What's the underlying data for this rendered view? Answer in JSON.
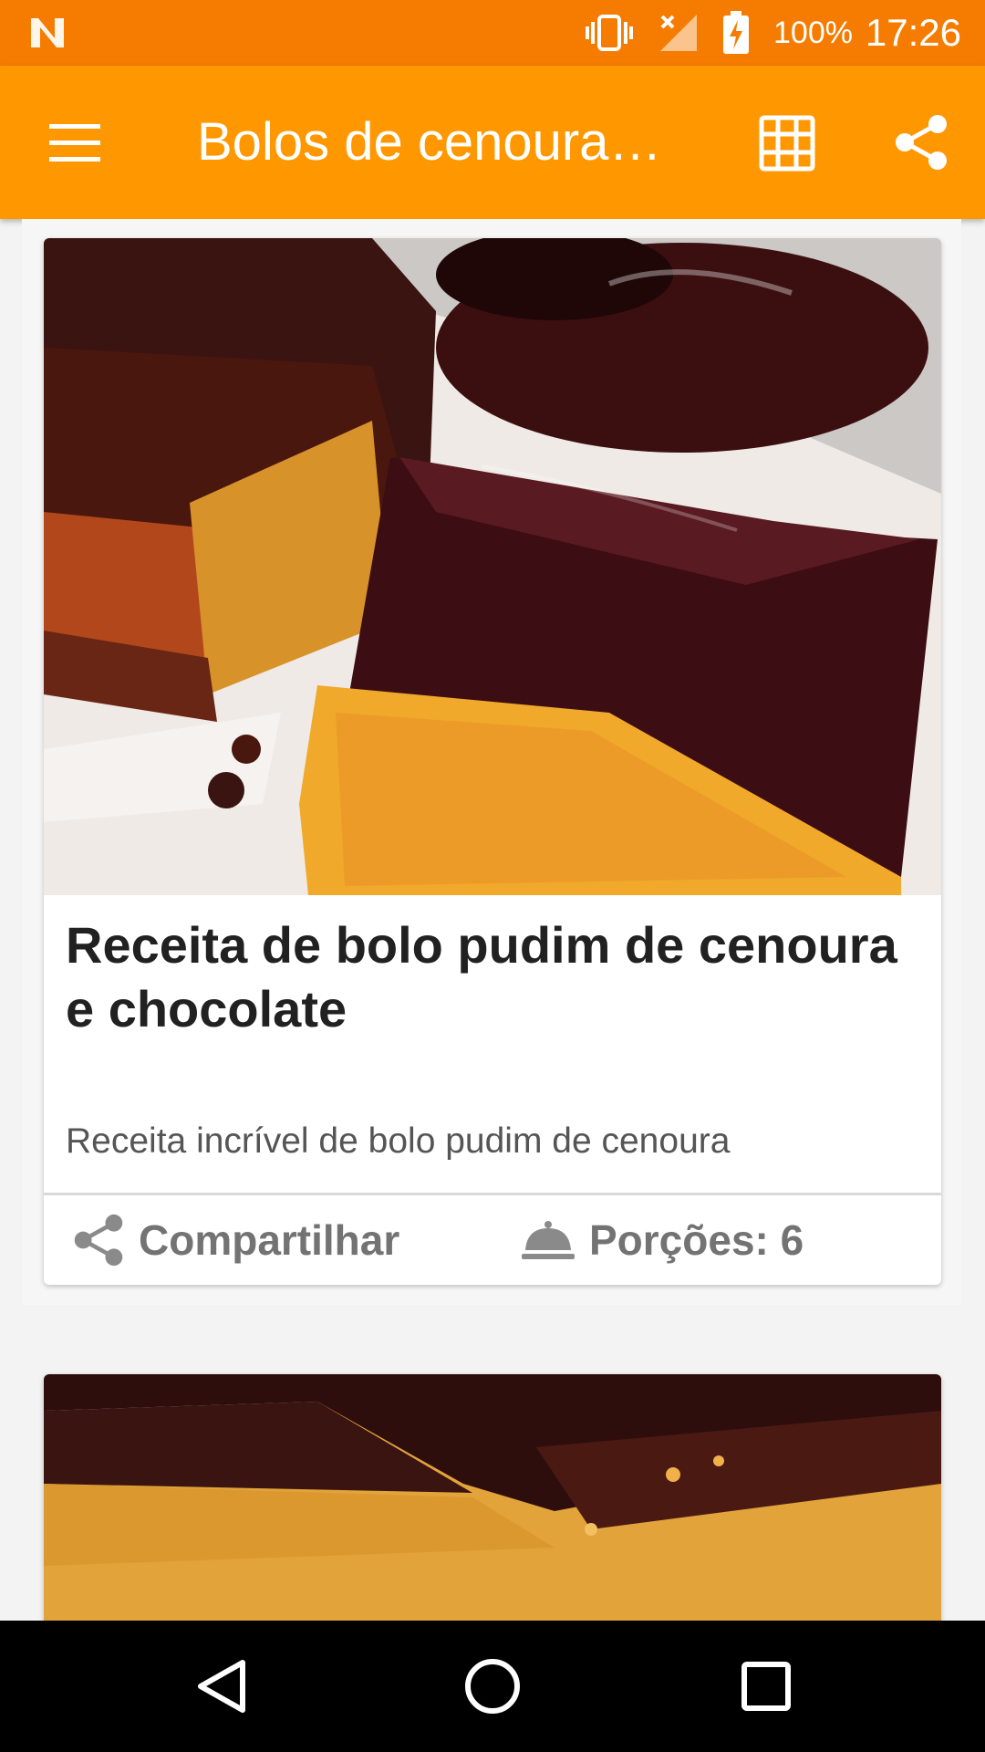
{
  "status_bar": {
    "battery": "100%",
    "time": "17:26",
    "icons": [
      "n-notification-icon",
      "vibrate-icon",
      "no-signal-icon",
      "battery-charging-icon"
    ]
  },
  "app_bar": {
    "title": "Bolos de cenoura com...",
    "icons": [
      "menu-icon",
      "grid-view-icon",
      "share-icon"
    ]
  },
  "recipes": [
    {
      "title": "Receita de bolo pudim de cenoura e chocolate",
      "description": "Receita incrível de bolo pudim de cenoura",
      "share_label": "Compartilhar",
      "portions_label": "Porções: 6"
    }
  ],
  "nav_bar": {
    "icons": [
      "back-icon",
      "home-icon",
      "recents-icon"
    ]
  },
  "colors": {
    "status_bar": "#f57c00",
    "app_bar": "#ff9800",
    "nav_bar": "#000000"
  }
}
